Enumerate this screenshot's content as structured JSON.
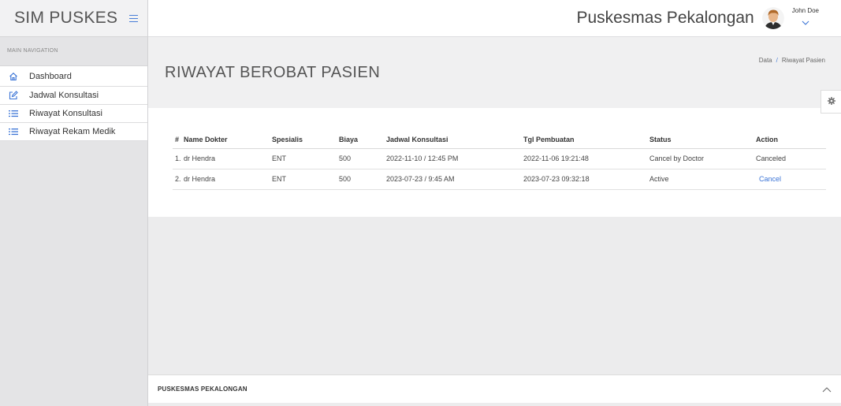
{
  "app": {
    "brand": "SIM PUSKES",
    "site_title": "Puskesmas Pekalongan",
    "user_name": "John Doe"
  },
  "sidebar": {
    "heading": "MAIN NAVIGATION",
    "items": [
      {
        "label": "Dashboard",
        "icon": "home-icon"
      },
      {
        "label": "Jadwal Konsultasi",
        "icon": "edit-icon"
      },
      {
        "label": "Riwayat Konsultasi",
        "icon": "list-icon"
      },
      {
        "label": "Riwayat Rekam Medik",
        "icon": "list-icon"
      }
    ]
  },
  "page": {
    "title": "RIWAYAT BEROBAT PASIEN",
    "breadcrumb": {
      "root": "Data",
      "separator": "/",
      "current": "Riwayat Pasien"
    }
  },
  "table": {
    "headers": [
      "#",
      "Name Dokter",
      "Spesialis",
      "Biaya",
      "Jadwal Konsultasi",
      "Tgl Pembuatan",
      "Status",
      "Action"
    ],
    "rows": [
      {
        "num": "1.",
        "name": "dr Hendra",
        "spesialis": "ENT",
        "biaya": "500",
        "jadwal": "2022-11-10 / 12:45 PM",
        "tgl": "2022-11-06 19:21:48",
        "status": "Cancel by Doctor",
        "action": "Canceled"
      },
      {
        "num": "2.",
        "name": "dr Hendra",
        "spesialis": "ENT",
        "biaya": "500",
        "jadwal": "2023-07-23 / 9:45 AM",
        "tgl": "2023-07-23 09:32:18",
        "status": "Active",
        "action": "Cancel"
      }
    ]
  },
  "footer": {
    "text": "PUSKESMAS PEKALONGAN"
  },
  "colors": {
    "accent": "#3b74d6",
    "sidebar_bg": "#e4e4e6",
    "content_bg": "#ececed"
  }
}
